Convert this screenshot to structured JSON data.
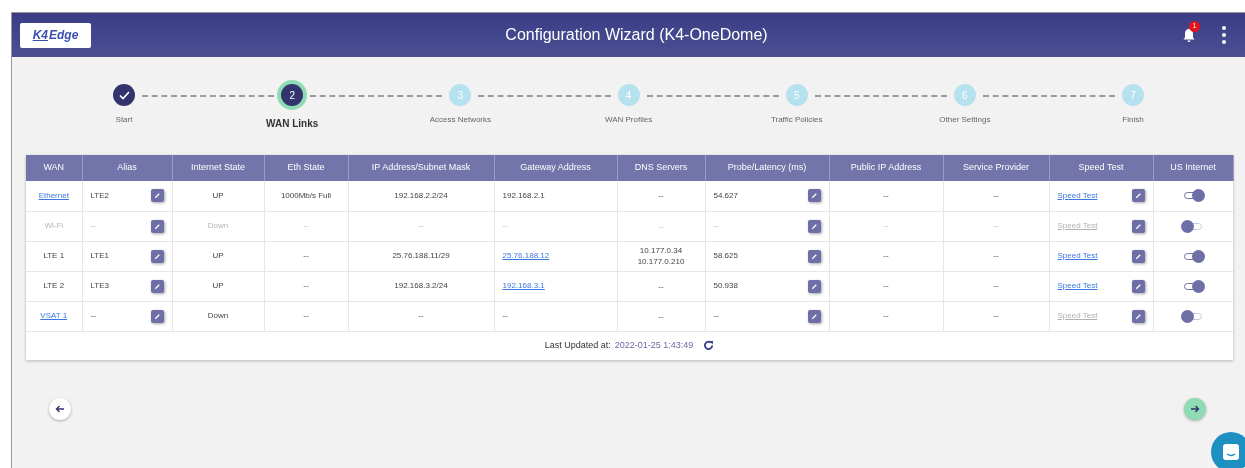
{
  "header": {
    "logo": {
      "mark": "K4",
      "text": "Edge"
    },
    "title": "Configuration Wizard (K4-OneDome)",
    "notifications": "1"
  },
  "steps": [
    {
      "label": "Start",
      "completed": true,
      "selected": false
    },
    {
      "label": "WAN Links",
      "number": "2",
      "completed": false,
      "selected": true
    },
    {
      "label": "Access Networks",
      "number": "3",
      "completed": false,
      "selected": false
    },
    {
      "label": "WAN Profiles",
      "number": "4",
      "completed": false,
      "selected": false
    },
    {
      "label": "Traffic Policies",
      "number": "5",
      "completed": false,
      "selected": false
    },
    {
      "label": "Other Settings",
      "number": "6",
      "completed": false,
      "selected": false
    },
    {
      "label": "Finish",
      "number": "7",
      "completed": false,
      "selected": false
    }
  ],
  "table": {
    "columns": [
      "WAN",
      "Alias",
      "Internet State",
      "Eth State",
      "IP Address/Subnet Mask",
      "Gateway Address",
      "DNS Servers",
      "Probe/Latency (ms)",
      "Public IP Address",
      "Service Provider",
      "Speed Test",
      "US Internet"
    ],
    "rows": [
      {
        "disabled": false,
        "wan": {
          "text": "Ethernet",
          "link": true
        },
        "alias": "LTE2",
        "internet_state": "UP",
        "eth_state": "1000Mb/s Full",
        "ip": "192.168.2.2/24",
        "gateway": {
          "text": "192.168.2.1",
          "link": false
        },
        "dns": [
          "--"
        ],
        "probe": "54.627",
        "public_ip": "--",
        "provider": "--",
        "speed_test": {
          "text": "Speed Test",
          "enabled": true
        },
        "us_internet": {
          "on": true
        }
      },
      {
        "disabled": true,
        "wan": {
          "text": "Wi-Fi",
          "link": false
        },
        "alias": "--",
        "internet_state": "Down",
        "eth_state": "--",
        "ip": "--",
        "gateway": {
          "text": "--",
          "link": false
        },
        "dns": [
          "--"
        ],
        "probe": "--",
        "public_ip": "--",
        "provider": "--",
        "speed_test": {
          "text": "Speed Test",
          "enabled": false
        },
        "us_internet": {
          "on": false
        }
      },
      {
        "disabled": false,
        "wan": {
          "text": "LTE 1",
          "link": false
        },
        "alias": "LTE1",
        "internet_state": "UP",
        "eth_state": "--",
        "ip": "25.76.188.11/29",
        "gateway": {
          "text": "25.76.188.12",
          "link": true
        },
        "dns": [
          "10.177.0.34",
          "10.177.0.210"
        ],
        "probe": "58.625",
        "public_ip": "--",
        "provider": "--",
        "speed_test": {
          "text": "Speed Test",
          "enabled": true
        },
        "us_internet": {
          "on": true
        }
      },
      {
        "disabled": false,
        "wan": {
          "text": "LTE 2",
          "link": false
        },
        "alias": "LTE3",
        "internet_state": "UP",
        "eth_state": "--",
        "ip": "192.168.3.2/24",
        "gateway": {
          "text": "192.168.3.1",
          "link": true
        },
        "dns": [
          "--"
        ],
        "probe": "50.938",
        "public_ip": "--",
        "provider": "--",
        "speed_test": {
          "text": "Speed Test",
          "enabled": true
        },
        "us_internet": {
          "on": true
        }
      },
      {
        "disabled": false,
        "wan": {
          "text": "VSAT 1",
          "link": true
        },
        "alias": "--",
        "internet_state": "Down",
        "eth_state": "--",
        "ip": "--",
        "gateway": {
          "text": "--",
          "link": false
        },
        "dns": [
          "--"
        ],
        "probe": "--",
        "public_ip": "--",
        "provider": "--",
        "speed_test": {
          "text": "Speed Test",
          "enabled": false
        },
        "us_internet": {
          "on": false
        }
      }
    ]
  },
  "last_updated": {
    "label": "Last Updated at:",
    "value": "2022-01-25 1:43:49"
  }
}
